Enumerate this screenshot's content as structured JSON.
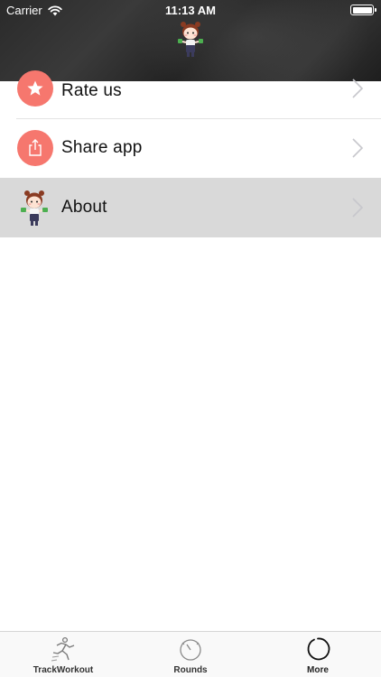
{
  "status_bar": {
    "carrier": "Carrier",
    "time": "11:13 AM"
  },
  "header": {
    "logo_icon": "girl-with-dumbbells-icon"
  },
  "menu": {
    "items": [
      {
        "label": "Rate us",
        "icon": "star-icon"
      },
      {
        "label": "Share app",
        "icon": "share-icon"
      },
      {
        "label": "About",
        "icon": "girl-with-dumbbells-icon",
        "selected": true
      }
    ]
  },
  "tab_bar": {
    "tabs": [
      {
        "label": "TrackWorkout",
        "icon": "running-figure-icon"
      },
      {
        "label": "Rounds",
        "icon": "timer-icon"
      },
      {
        "label": "More",
        "icon": "circle-arc-icon",
        "active": true
      }
    ]
  },
  "colors": {
    "accent": "#f6776e",
    "header_bg": "#2b2b2b",
    "selected_row": "#d9d9d9"
  }
}
